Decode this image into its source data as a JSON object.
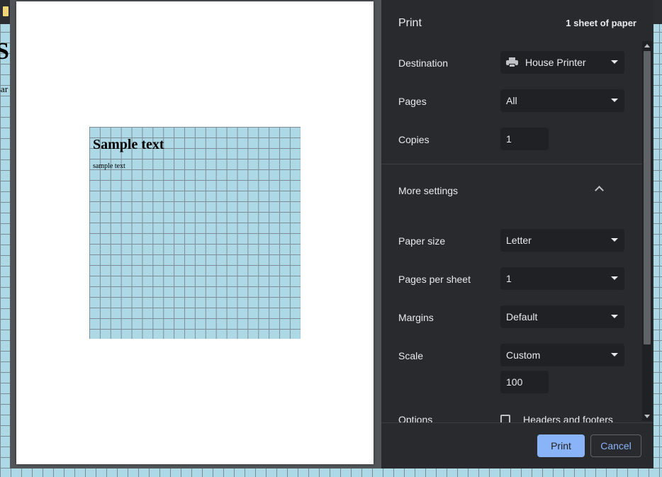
{
  "background": {
    "heading": "S",
    "subtext": "sar"
  },
  "preview": {
    "sheet_title": "Sample text",
    "sheet_subtext": "sample text"
  },
  "panel": {
    "title": "Print",
    "sheet_count": "1 sheet of paper",
    "destination": {
      "label": "Destination",
      "value": "House Printer",
      "icon": "printer-icon"
    },
    "pages": {
      "label": "Pages",
      "value": "All"
    },
    "copies": {
      "label": "Copies",
      "value": "1"
    },
    "more_settings": {
      "label": "More settings",
      "expanded": true
    },
    "paper_size": {
      "label": "Paper size",
      "value": "Letter"
    },
    "pages_per_sheet": {
      "label": "Pages per sheet",
      "value": "1"
    },
    "margins": {
      "label": "Margins",
      "value": "Default"
    },
    "scale": {
      "label": "Scale",
      "value": "Custom",
      "custom_value": "100"
    },
    "options": {
      "label": "Options",
      "headers_footers": {
        "label": "Headers and footers",
        "checked": false
      }
    }
  },
  "footer": {
    "print_label": "Print",
    "cancel_label": "Cancel"
  },
  "colors": {
    "panel_bg": "#292a2d",
    "field_bg": "#202124",
    "accent": "#8ab4f8",
    "page_bg_grid": "#add8e6"
  }
}
